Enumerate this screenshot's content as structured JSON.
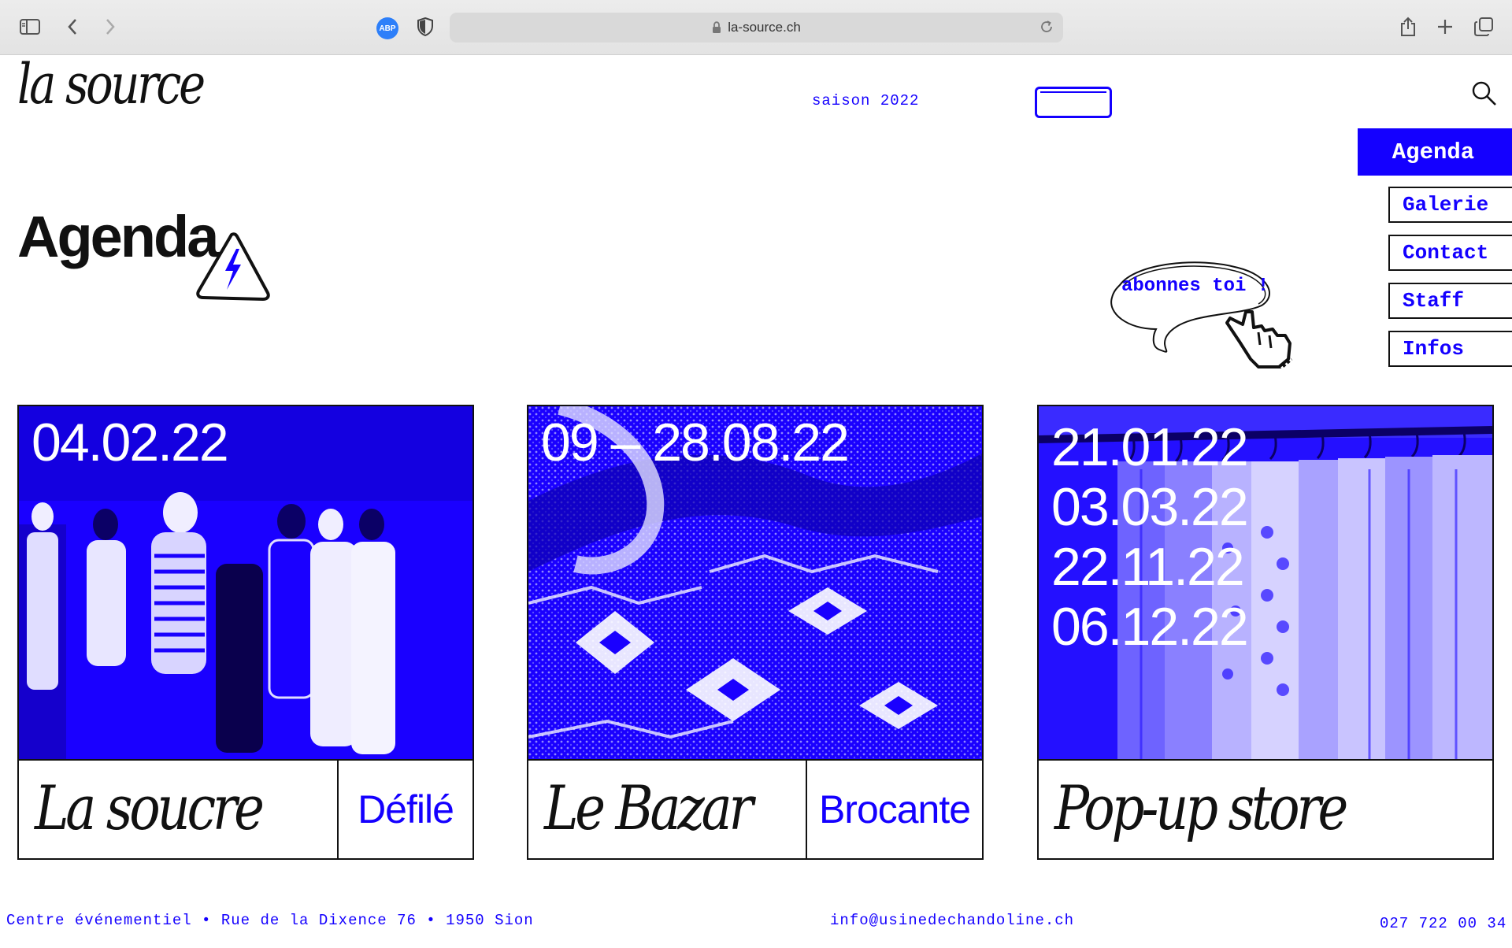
{
  "browser": {
    "url": "la-source.ch",
    "adblock_label": "ABP"
  },
  "header": {
    "logo": "la source",
    "season": "saison 2022"
  },
  "nav": {
    "active": "Agenda",
    "items": [
      "Galerie",
      "Contact",
      "Staff",
      "Infos"
    ]
  },
  "page": {
    "title": "Agenda",
    "subscribe": "abonnes toi !"
  },
  "events": [
    {
      "dates": [
        "04.02.22"
      ],
      "name": "La soucre",
      "category": "Défilé"
    },
    {
      "dates": [
        "09 – 28.08.22"
      ],
      "name": "Le Bazar",
      "category": "Brocante"
    },
    {
      "dates": [
        "21.01.22",
        "03.03.22",
        "22.11.22",
        "06.12.22"
      ],
      "name": "Pop-up store",
      "category": ""
    }
  ],
  "footer": {
    "address": "Centre événementiel • Rue de la Dixence 76 • 1950 Sion",
    "email": "info@usinedechandoline.ch",
    "phone": "027 722 00 34"
  },
  "colors": {
    "accent": "#1400ff",
    "text": "#111111"
  },
  "icons": [
    "sidebar-icon",
    "back-icon",
    "forward-icon",
    "shield-icon",
    "lock-icon",
    "reload-icon",
    "share-icon",
    "new-tab-icon",
    "tabs-icon",
    "search-icon",
    "ticket-icon",
    "warning-icon",
    "pointer-hand-icon"
  ]
}
